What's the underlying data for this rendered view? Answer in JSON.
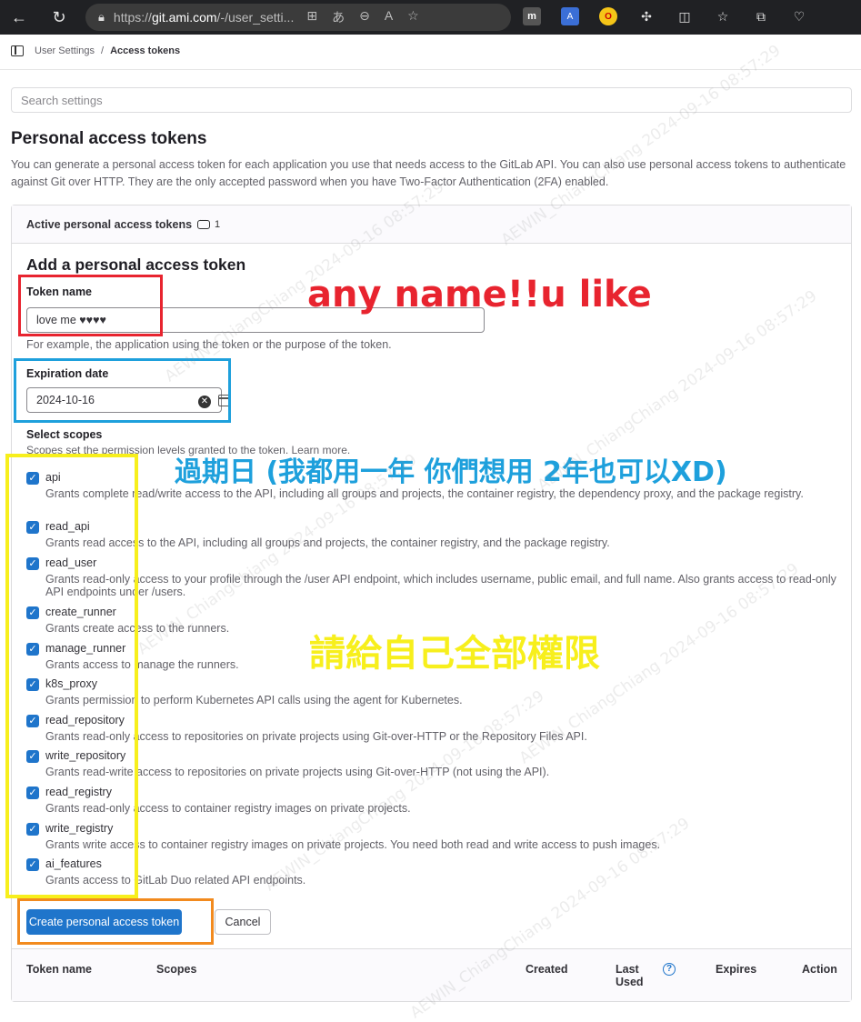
{
  "browser": {
    "url_prefix": "https://",
    "url_host": "git.ami.com",
    "url_path": "/-/user_setti..."
  },
  "breadcrumb": {
    "parent": "User Settings",
    "separator": "/",
    "current": "Access tokens"
  },
  "search": {
    "placeholder": "Search settings"
  },
  "page": {
    "title": "Personal access tokens",
    "intro": "You can generate a personal access token for each application you use that needs access to the GitLab API. You can also use personal access tokens to authenticate against Git over HTTP. They are the only accepted password when you have Two-Factor Authentication (2FA) enabled."
  },
  "active_tokens": {
    "label": "Active personal access tokens",
    "count": "1"
  },
  "form": {
    "title": "Add a personal access token",
    "token_name_label": "Token name",
    "token_name_value": "love me ♥♥♥♥",
    "token_name_help": "For example, the application using the token or the purpose of the token.",
    "expiration_label": "Expiration date",
    "expiration_value": "2024-10-16",
    "scopes_label": "Select scopes",
    "scopes_help": "Scopes set the permission levels granted to the token. Learn more."
  },
  "scopes": [
    {
      "name": "api",
      "checked": true,
      "desc": "Grants complete read/write access to the API, including all groups and projects, the container registry, the dependency proxy, and the package registry."
    },
    {
      "name": "read_api",
      "checked": true,
      "desc": "Grants read access to the API, including all groups and projects, the container registry, and the package registry."
    },
    {
      "name": "read_user",
      "checked": true,
      "desc": "Grants read-only access to your profile through the /user API endpoint, which includes username, public email, and full name. Also grants access to read-only API endpoints under /users."
    },
    {
      "name": "create_runner",
      "checked": true,
      "desc": "Grants create access to the runners."
    },
    {
      "name": "manage_runner",
      "checked": true,
      "desc": "Grants access to manage the runners."
    },
    {
      "name": "k8s_proxy",
      "checked": true,
      "desc": "Grants permission to perform Kubernetes API calls using the agent for Kubernetes."
    },
    {
      "name": "read_repository",
      "checked": true,
      "desc": "Grants read-only access to repositories on private projects using Git-over-HTTP or the Repository Files API."
    },
    {
      "name": "write_repository",
      "checked": true,
      "desc": "Grants read-write access to repositories on private projects using Git-over-HTTP (not using the API)."
    },
    {
      "name": "read_registry",
      "checked": true,
      "desc": "Grants read-only access to container registry images on private projects."
    },
    {
      "name": "write_registry",
      "checked": true,
      "desc": "Grants write access to container registry images on private projects. You need both read and write access to push images."
    },
    {
      "name": "ai_features",
      "checked": true,
      "desc": "Grants access to GitLab Duo related API endpoints."
    }
  ],
  "buttons": {
    "create": "Create personal access token",
    "cancel": "Cancel"
  },
  "table": {
    "col_token_name": "Token name",
    "col_scopes": "Scopes",
    "col_created": "Created",
    "col_last_used_1": "Last",
    "col_last_used_2": "Used",
    "col_expires": "Expires",
    "col_action": "Action"
  },
  "annotations": {
    "name_note": "any name!!u like",
    "expiry_note": "過期日 (我都用一年 你們想用 2年也可以XD)",
    "scope_note": "請給自己全部權限",
    "colors": {
      "red": "#e8242f",
      "blue": "#1ea0dc",
      "yellow": "#f7ef1c",
      "orange": "#f28a1e"
    }
  },
  "watermark": "AEWIN_ChiangChiang 2024-09-16 08:57:29"
}
